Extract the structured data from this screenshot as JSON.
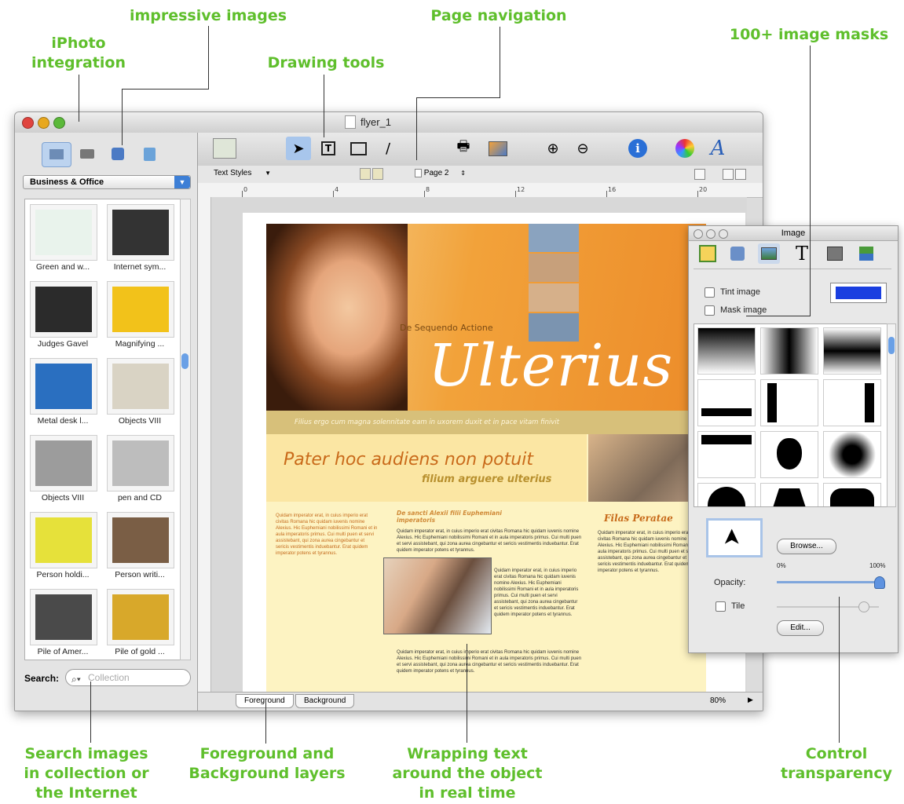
{
  "callouts": {
    "iphoto": [
      "iPhoto",
      "integration"
    ],
    "impressive": "impressive images",
    "drawing": "Drawing tools",
    "pagenav": "Page navigation",
    "masks": "100+ image masks",
    "search": [
      "Search images",
      "in collection or",
      "the Internet"
    ],
    "layers": [
      "Foreground and",
      "Background layers"
    ],
    "wrap": [
      "Wrapping text",
      "around the object",
      "in real time"
    ],
    "transparency": [
      "Control",
      "transparency"
    ]
  },
  "window": {
    "title": "flyer_1"
  },
  "sidebar": {
    "category": "Business & Office",
    "items": [
      {
        "label": "Green and w...",
        "color": "#e9f3ec"
      },
      {
        "label": "Internet sym...",
        "color": "#333333"
      },
      {
        "label": "Judges Gavel",
        "color": "#2b2b2b"
      },
      {
        "label": "Magnifying ...",
        "color": "#f2c21a"
      },
      {
        "label": "Metal desk l...",
        "color": "#2a6fc0"
      },
      {
        "label": "Objects VIII",
        "color": "#d9d3c4"
      },
      {
        "label": "Objects VIII",
        "color": "#9c9c9c"
      },
      {
        "label": "pen and CD",
        "color": "#bdbdbd"
      },
      {
        "label": "Person holdi...",
        "color": "#e6e13a"
      },
      {
        "label": "Person writi...",
        "color": "#7a5e45"
      },
      {
        "label": "Pile of Amer...",
        "color": "#4a4a4a"
      },
      {
        "label": "Pile of gold ...",
        "color": "#d8a82a"
      }
    ],
    "search_label": "Search:",
    "search_placeholder": "Collection"
  },
  "subbar": {
    "text_styles": "Text Styles",
    "page": "Page 2"
  },
  "ruler": [
    "0",
    "4",
    "8",
    "12",
    "16",
    "20"
  ],
  "flyer": {
    "subtitle": "De Sequendo Actione",
    "title": "Ulterius",
    "tagline": "Filius ergo cum magna solennitate eam in uxorem duxit et in pace vitam finivit",
    "headline": "Pater hoc audiens non potuit",
    "subheadline": "filium arguere ulterius",
    "col2_head": "De sancti Alexii filii Euphemiani imperatoris",
    "col3_head": "Filas Peratae",
    "lorem": "Quidam imperator erat, in cuius imperio erat civitas Romana hic quidam iuvenis nomine Alexius. Hic Euphemiani nobilissimi Romani et in aula imperatoris primus. Cui multi puen et servi assistebant, qui zona aurea cingebantur et sericis vestimentis induebantur. Erat quidem imperator potens et tyrannus."
  },
  "bottom": {
    "foreground": "Foreground",
    "background": "Background",
    "zoom": "80%"
  },
  "inspector": {
    "title": "Image",
    "tint_label": "Tint image",
    "tint_color": "#1a3fe0",
    "mask_label": "Mask image",
    "browse": "Browse...",
    "opacity_label": "Opacity:",
    "opacity_min": "0%",
    "opacity_max": "100%",
    "opacity_value": 1.0,
    "tile_label": "Tile",
    "edit": "Edit..."
  }
}
